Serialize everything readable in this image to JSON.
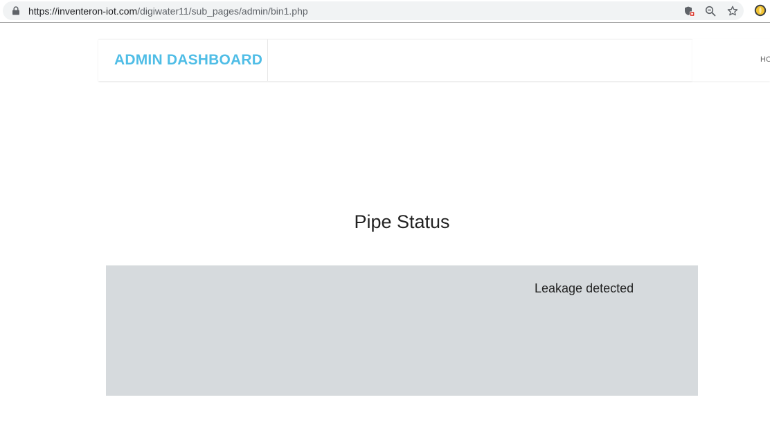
{
  "browser": {
    "url_host": "https://inventeron-iot.com",
    "url_path": "/digiwater11/sub_pages/admin/bin1.php",
    "icons": [
      "lock-icon",
      "shield-blocked-icon",
      "zoom-out-icon",
      "bookmark-star-icon",
      "extension-icon"
    ]
  },
  "header": {
    "brand": "ADMIN DASHBOARD",
    "nav_home": "HO"
  },
  "main": {
    "title": "Pipe Status",
    "status_message": "Leakage detected"
  },
  "colors": {
    "brand": "#4fbde6",
    "panel_bg": "#d6dadd",
    "text": "#222222"
  }
}
